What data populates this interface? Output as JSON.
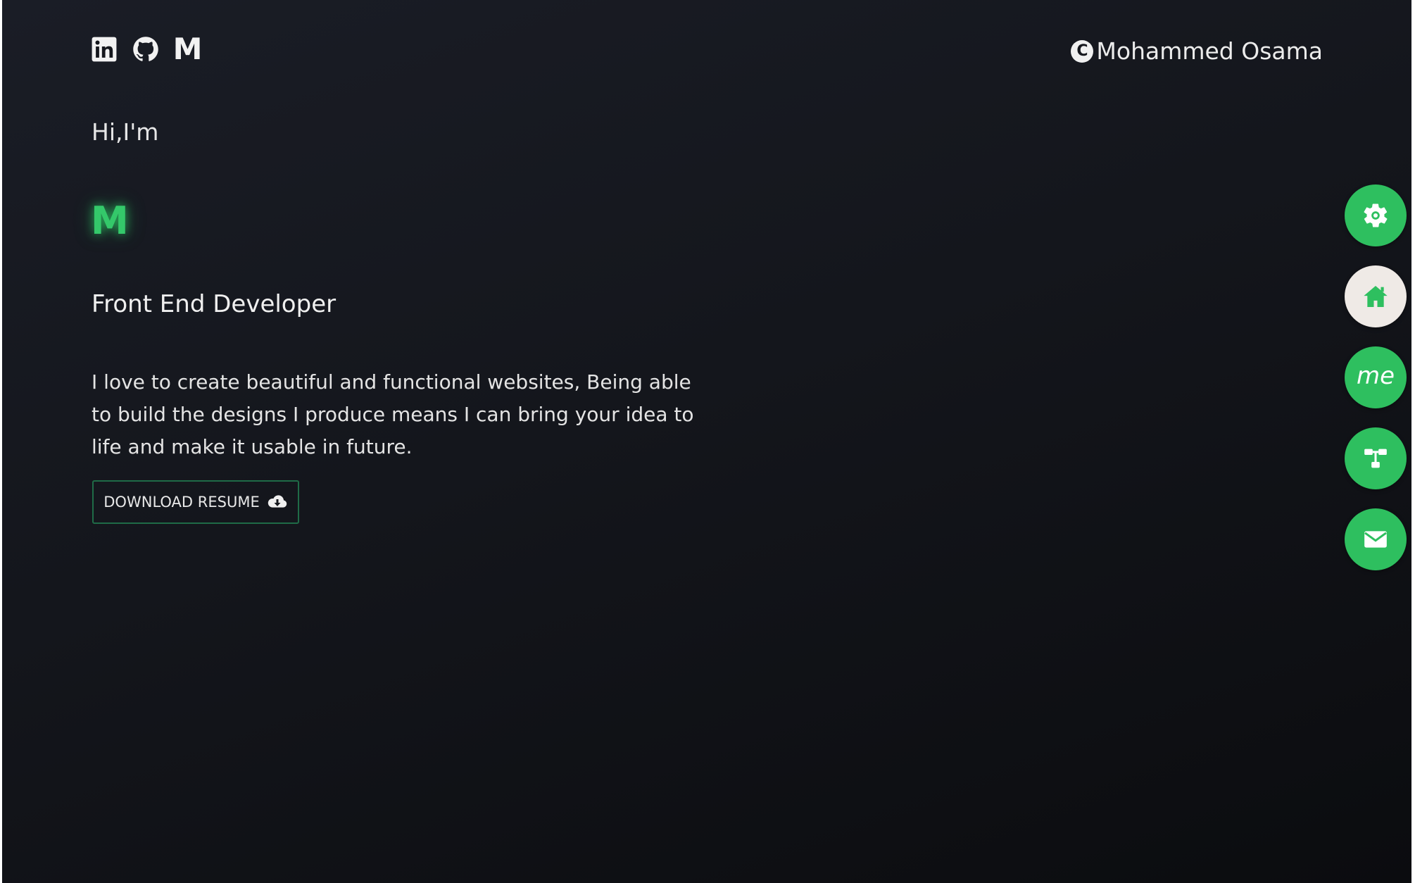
{
  "social": {
    "items": [
      {
        "icon": "linkedin-icon"
      },
      {
        "icon": "github-icon"
      },
      {
        "icon": "medium-icon",
        "glyph": "M"
      }
    ]
  },
  "brand": {
    "copyright_symbol": "C",
    "name": "Mohammed Osama"
  },
  "hero": {
    "greeting": "Hi,I'm",
    "logo_letter": "M",
    "role": "Front End Developer",
    "bio": "I love to create beautiful and functional websites, Being able to build the designs I produce means I can bring your idea to life and make it usable in future.",
    "resume_button": "DOWNLOAD RESUME"
  },
  "side_nav": {
    "items": [
      {
        "icon": "gear-icon",
        "active": false
      },
      {
        "icon": "home-icon",
        "active": true
      },
      {
        "icon": "me-icon",
        "label": "me",
        "active": false
      },
      {
        "icon": "projects-icon",
        "active": false
      },
      {
        "icon": "mail-icon",
        "active": false
      }
    ]
  },
  "colors": {
    "accent": "#2ebf5f",
    "glow": "#34c86a",
    "active_nav": "#efeae6",
    "background": "#14161c"
  }
}
